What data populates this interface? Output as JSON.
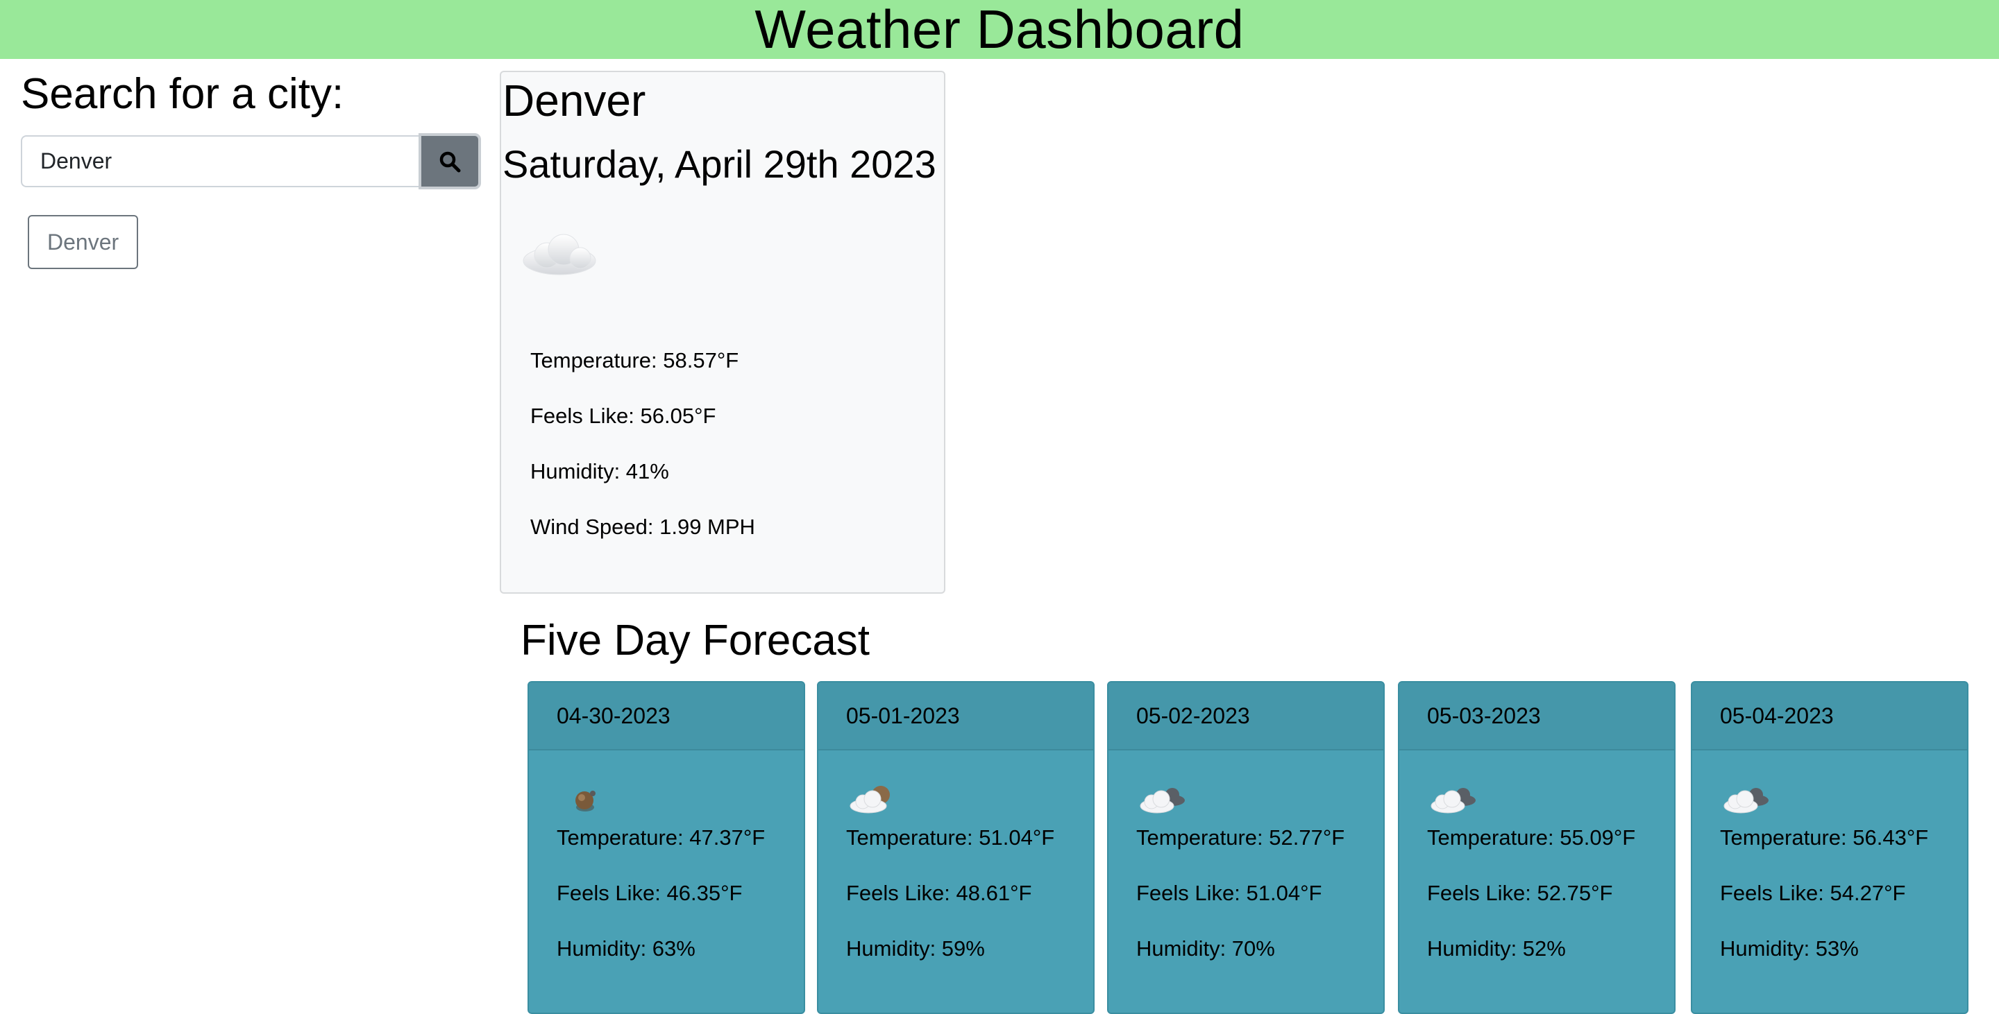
{
  "header": {
    "title": "Weather Dashboard"
  },
  "search": {
    "title": "Search for a city:",
    "value": "Denver",
    "button_icon": "search-icon",
    "history": [
      "Denver"
    ]
  },
  "current": {
    "city": "Denver",
    "date": "Saturday, April 29th 2023",
    "icon": "cloud-icon",
    "temperature": "Temperature: 58.57°F",
    "feels_like": "Feels Like: 56.05°F",
    "humidity": "Humidity: 41%",
    "wind": "Wind Speed: 1.99 MPH"
  },
  "forecast": {
    "title": "Five Day Forecast",
    "days": [
      {
        "date": "04-30-2023",
        "icon": "rain-cloud-icon",
        "temperature": "Temperature: 47.37°F",
        "feels_like": "Feels Like: 46.35°F",
        "humidity": "Humidity: 63%"
      },
      {
        "date": "05-01-2023",
        "icon": "partly-cloudy-icon",
        "temperature": "Temperature: 51.04°F",
        "feels_like": "Feels Like: 48.61°F",
        "humidity": "Humidity: 59%"
      },
      {
        "date": "05-02-2023",
        "icon": "cloudy-icon",
        "temperature": "Temperature: 52.77°F",
        "feels_like": "Feels Like: 51.04°F",
        "humidity": "Humidity: 70%"
      },
      {
        "date": "05-03-2023",
        "icon": "cloudy-icon",
        "temperature": "Temperature: 55.09°F",
        "feels_like": "Feels Like: 52.75°F",
        "humidity": "Humidity: 52%"
      },
      {
        "date": "05-04-2023",
        "icon": "cloudy-icon",
        "temperature": "Temperature: 56.43°F",
        "feels_like": "Feels Like: 54.27°F",
        "humidity": "Humidity: 53%"
      }
    ]
  }
}
